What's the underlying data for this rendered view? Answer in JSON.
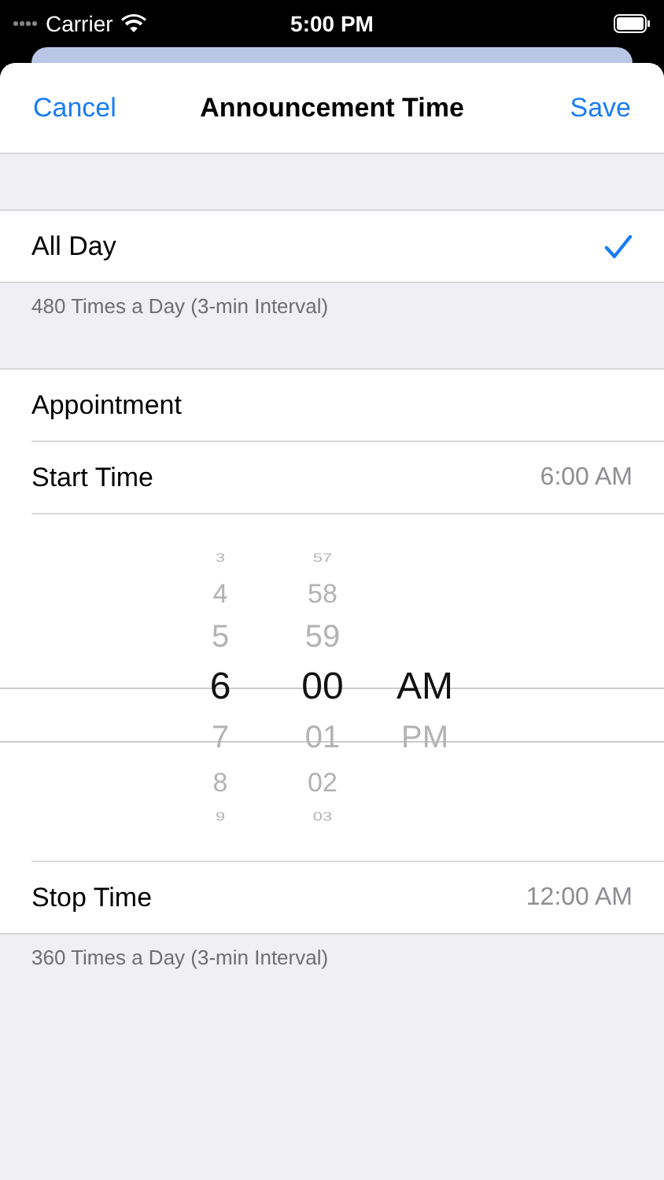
{
  "status_bar": {
    "carrier": "Carrier",
    "time": "5:00 PM"
  },
  "nav": {
    "cancel": "Cancel",
    "title": "Announcement Time",
    "save": "Save"
  },
  "sections": [
    {
      "rows": [
        {
          "kind": "check",
          "label": "All Day",
          "checked": true
        }
      ],
      "footer": "480 Times a Day (3-min Interval)"
    },
    {
      "rows": [
        {
          "kind": "plain",
          "label": "Appointment"
        },
        {
          "kind": "value",
          "label": "Start Time",
          "value": "6:00 AM"
        },
        {
          "kind": "picker",
          "columns": [
            {
              "items": [
                {
                  "label": "3",
                  "selected": false
                },
                {
                  "label": "4",
                  "selected": false
                },
                {
                  "label": "5",
                  "selected": false
                },
                {
                  "label": "6",
                  "selected": true
                },
                {
                  "label": "7",
                  "selected": false
                },
                {
                  "label": "8",
                  "selected": false
                },
                {
                  "label": "9",
                  "selected": false
                }
              ]
            },
            {
              "items": [
                {
                  "label": "57",
                  "selected": false
                },
                {
                  "label": "58",
                  "selected": false
                },
                {
                  "label": "59",
                  "selected": false
                },
                {
                  "label": "00",
                  "selected": true
                },
                {
                  "label": "01",
                  "selected": false
                },
                {
                  "label": "02",
                  "selected": false
                },
                {
                  "label": "03",
                  "selected": false
                }
              ]
            },
            {
              "items": [
                {
                  "label": "AM",
                  "selected": true
                },
                {
                  "label": "PM",
                  "selected": false
                }
              ]
            }
          ]
        },
        {
          "kind": "value",
          "label": "Stop Time",
          "value": "12:00 AM"
        }
      ],
      "footer": "360 Times a Day (3-min Interval)"
    }
  ]
}
